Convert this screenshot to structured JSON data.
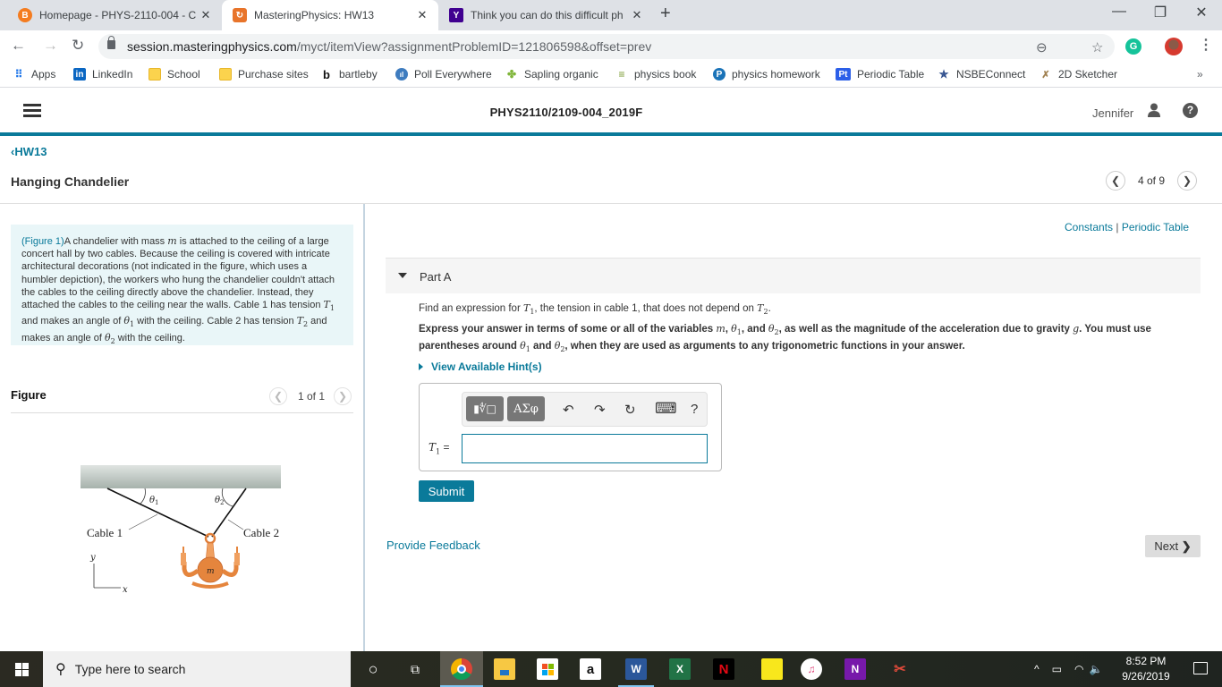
{
  "browser": {
    "tabs": [
      {
        "title": "Homepage - PHYS-2110-004 - C",
        "icon": "brightspace-icon",
        "icon_color": "#f47c20",
        "active": false
      },
      {
        "title": "MasteringPhysics: HW13",
        "icon": "mastering-icon",
        "icon_color": "#e8742a",
        "active": true
      },
      {
        "title": "Think you can do this difficult ph",
        "icon": "yahoo-icon",
        "icon_color": "#400090",
        "active": false
      }
    ],
    "new_tab": "+",
    "url_host": "session.masteringphysics.com",
    "url_path": "/myct/itemView?assignmentProblemID=121806598&offset=prev",
    "bookmarks": [
      {
        "label": "Apps",
        "icon": "apps-grid-icon"
      },
      {
        "label": "LinkedIn",
        "icon": "linkedin-icon"
      },
      {
        "label": "School",
        "icon": "folder-icon"
      },
      {
        "label": "Purchase sites",
        "icon": "folder-icon"
      },
      {
        "label": "bartleby",
        "icon": "bartleby-icon"
      },
      {
        "label": "Poll Everywhere",
        "icon": "poll-everywhere-icon"
      },
      {
        "label": "Sapling organic",
        "icon": "sapling-icon"
      },
      {
        "label": "physics book",
        "icon": "book-icon"
      },
      {
        "label": "physics homework",
        "icon": "pearson-icon"
      },
      {
        "label": "Periodic Table",
        "icon": "periodic-table-icon"
      },
      {
        "label": "NSBEConnect",
        "icon": "nsbe-icon"
      },
      {
        "label": "2D Sketcher",
        "icon": "sketcher-icon"
      }
    ],
    "more_bookmarks": "»"
  },
  "header": {
    "course": "PHYS2110/2109-004_2019F",
    "user": "Jennifer",
    "help": "?"
  },
  "nav": {
    "back_label": "HW13",
    "problem_title": "Hanging Chandelier",
    "pager_text": "4 of 9"
  },
  "intro": {
    "fig_link": "(Figure 1)",
    "seg1": "A chandelier with mass ",
    "m": "m",
    "seg2": " is attached to the ceiling of a large concert hall by two cables. Because the ceiling is covered with intricate architectural decorations (not indicated in the figure, which uses a humbler depiction), the workers who hung the chandelier couldn't attach the cables to the ceiling directly above the chandelier. Instead, they attached the cables to the ceiling near the walls. Cable 1 has tension ",
    "T1": "T",
    "seg3": " and makes an angle of ",
    "th1": "θ",
    "seg4": " with the ceiling. Cable 2 has tension ",
    "T2": "T",
    "seg5": " and makes an angle of ",
    "th2": "θ",
    "seg6": " with the ceiling.",
    "sub1": "1",
    "sub2": "2"
  },
  "figure": {
    "label": "Figure",
    "pager_text": "1 of 1",
    "cable1": "Cable 1",
    "cable2": "Cable 2",
    "theta1": "θ",
    "theta2": "θ",
    "sub1": "1",
    "sub2": "2",
    "mass": "m",
    "axis_y": "y",
    "axis_x": "x"
  },
  "links": {
    "constants": "Constants",
    "sep": " | ",
    "periodic_table": "Periodic Table"
  },
  "part": {
    "label": "Part A",
    "q_seg1": "Find an expression for ",
    "q_T1": "T",
    "q_seg2": ", the tension in cable 1, that does not depend on ",
    "q_T2": "T",
    "q_seg3": ".",
    "instr_seg1": "Express your answer in terms of some or all of the variables ",
    "instr_m": "m",
    "instr_seg2": ", ",
    "instr_th": "θ",
    "instr_seg3": ", and ",
    "instr_seg4": ", as well as the magnitude of the acceleration due to gravity ",
    "instr_g": "g",
    "instr_seg5": ". You must use parentheses around ",
    "instr_seg6": " and ",
    "instr_seg7": ", when they are used as arguments to any trigonometric functions in your answer.",
    "sub1": "1",
    "sub2": "2",
    "hints": "View Available Hint(s)",
    "answer_label_T": "T",
    "answer_label_eq": " =",
    "answer_value": "",
    "toolbar": {
      "templates": "▮∜□",
      "greek": "ΑΣφ",
      "undo": "↶",
      "redo": "↷",
      "reset": "↻",
      "keyboard": "⌨",
      "help": "?"
    },
    "submit": "Submit",
    "feedback": "Provide Feedback",
    "next": "Next"
  },
  "taskbar": {
    "search_placeholder": "Type here to search",
    "time": "8:52 PM",
    "date": "9/26/2019"
  }
}
